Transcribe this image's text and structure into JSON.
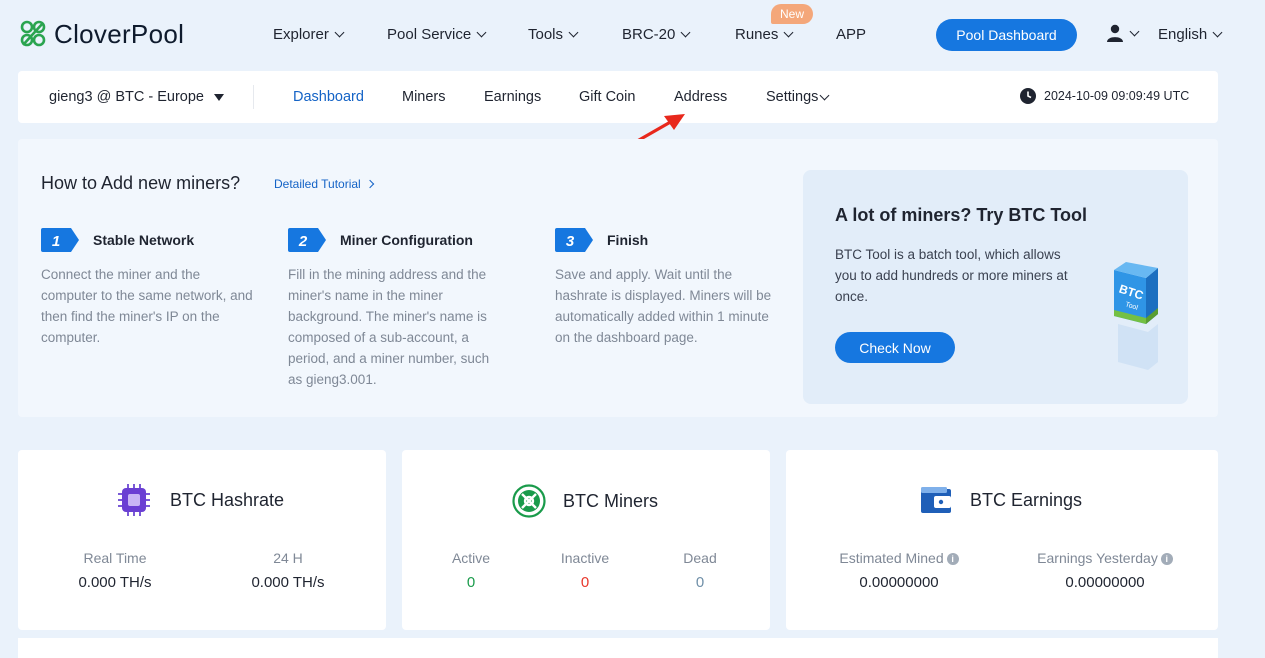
{
  "brand": {
    "name": "CloverPool"
  },
  "nav": {
    "explorer": "Explorer",
    "pool_service": "Pool Service",
    "tools": "Tools",
    "brc20": "BRC-20",
    "runes": "Runes",
    "runes_badge": "New",
    "app": "APP",
    "dashboard_button": "Pool Dashboard",
    "language": "English"
  },
  "subnav": {
    "account": "gieng3 @ BTC - Europe",
    "tabs": [
      "Dashboard",
      "Miners",
      "Earnings",
      "Gift Coin",
      "Address",
      "Settings"
    ],
    "active_tab": "Dashboard",
    "timestamp": "2024-10-09 09:09:49 UTC"
  },
  "howto": {
    "title": "How to Add new miners?",
    "tutorial_link": "Detailed Tutorial",
    "steps": [
      {
        "num": "1",
        "title": "Stable Network",
        "desc": [
          "Connect the miner and the",
          "computer to the same network, and",
          "then find the miner's IP on the",
          "computer."
        ]
      },
      {
        "num": "2",
        "title": "Miner Configuration",
        "desc": [
          "Fill in the mining address and the",
          "miner's name in the miner",
          "background. The miner's name is",
          "composed of a sub-account, a",
          "period, and a miner number, such",
          "as gieng3.001."
        ]
      },
      {
        "num": "3",
        "title": "Finish",
        "desc": [
          "Save and apply. Wait until the",
          "hashrate is displayed. Miners will be",
          "automatically added within 1 minute",
          "on the dashboard page."
        ]
      }
    ]
  },
  "tool": {
    "title": "A lot of miners? Try BTC Tool",
    "desc": [
      "BTC Tool is a batch tool, which allows",
      "you to add hundreds or more miners at",
      "once."
    ],
    "button": "Check Now",
    "icon_text": "BTC",
    "icon_subtext": "Tool"
  },
  "hashrate": {
    "title": "BTC Hashrate",
    "realtime_label": "Real Time",
    "realtime_value": "0.000 TH/s",
    "day_label": "24 H",
    "day_value": "0.000 TH/s"
  },
  "miners": {
    "title": "BTC Miners",
    "active_label": "Active",
    "active_value": "0",
    "inactive_label": "Inactive",
    "inactive_value": "0",
    "dead_label": "Dead",
    "dead_value": "0"
  },
  "earnings": {
    "title": "BTC Earnings",
    "estimated_label": "Estimated Mined",
    "estimated_value": "0.00000000",
    "yesterday_label": "Earnings Yesterday",
    "yesterday_value": "0.00000000"
  },
  "colors": {
    "accent": "#1677e0",
    "active_green": "#1a9b4b",
    "inactive_red": "#e8372c",
    "dead_gray": "#6f8fa8",
    "annotation_arrow": "#e8281c"
  }
}
